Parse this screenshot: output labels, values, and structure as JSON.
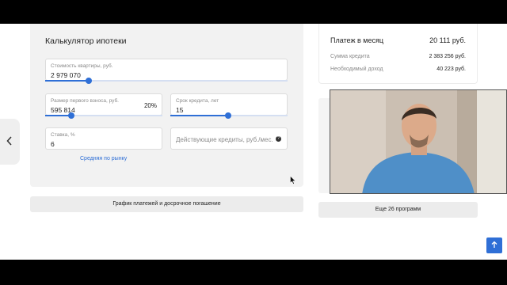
{
  "calculator": {
    "title": "Калькулятор ипотеки",
    "property_cost": {
      "label": "Стоимость квартиры, руб.",
      "value": "2 979 070",
      "slider_fraction": 0.18
    },
    "down_payment": {
      "label": "Размер первого взноса, руб.",
      "value": "595 814",
      "percent": "20%",
      "slider_fraction": 0.22
    },
    "term": {
      "label": "Срок кредита, лет",
      "value": "15",
      "slider_fraction": 0.49
    },
    "rate": {
      "label": "Ставка, %",
      "value": "6"
    },
    "existing_credits": {
      "placeholder": "Действующие кредиты, руб./мес.",
      "help_icon": "question-icon"
    },
    "market_link": "Средняя по рынку",
    "schedule_button": "График платежей и досрочное погашение"
  },
  "summary": {
    "monthly_label": "Платеж в месяц",
    "monthly_value": "20 111 руб.",
    "rows": [
      {
        "label": "Сумма кредита",
        "value": "2 383 256 руб."
      },
      {
        "label": "Необходимый доход",
        "value": "40 223 руб."
      }
    ]
  },
  "more_programs_button": "Еще 26 программ",
  "icons": {
    "back": "chevron-left-icon",
    "scroll_up": "arrow-up-icon"
  },
  "colors": {
    "accent": "#2f6fd6",
    "panel": "#f2f2f2"
  }
}
